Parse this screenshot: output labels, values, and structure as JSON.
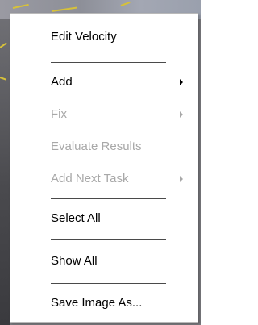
{
  "context_menu": {
    "items": [
      {
        "label": "Edit Velocity",
        "enabled": true,
        "submenu": false
      },
      {
        "label": "Add",
        "enabled": true,
        "submenu": true
      },
      {
        "label": "Fix",
        "enabled": false,
        "submenu": true
      },
      {
        "label": "Evaluate Results",
        "enabled": false,
        "submenu": false
      },
      {
        "label": "Add Next Task",
        "enabled": false,
        "submenu": true
      },
      {
        "label": "Select All",
        "enabled": true,
        "submenu": false
      },
      {
        "label": "Show All",
        "enabled": true,
        "submenu": false
      },
      {
        "label": "Save Image As...",
        "enabled": true,
        "submenu": false
      }
    ]
  },
  "colors": {
    "enabled_text": "#000000",
    "disabled_text": "#a8a8a8",
    "menu_background": "#ffffff",
    "separator": "#4a4a4a",
    "background_streaks": "#d6c13a"
  }
}
